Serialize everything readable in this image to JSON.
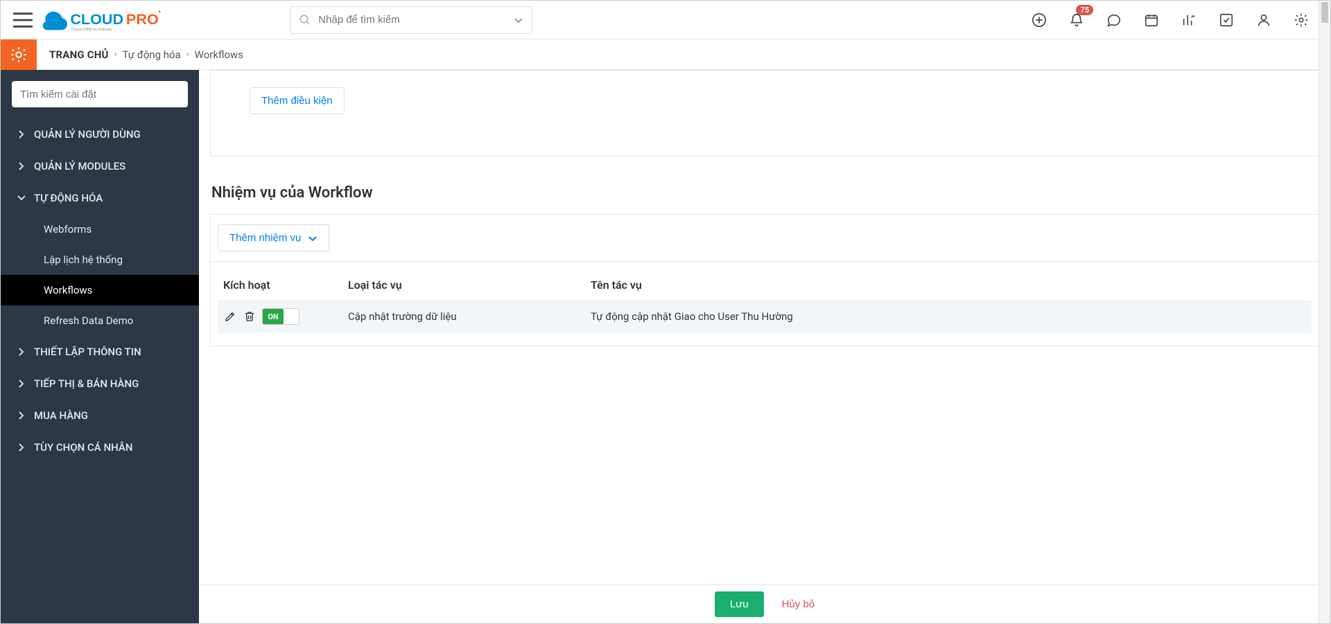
{
  "header": {
    "search_placeholder": "Nhập để tìm kiếm",
    "notification_count": "75",
    "logo": {
      "text1": "CLOUD",
      "text2": "PRO",
      "sub": "Cloud CRM by Industry"
    }
  },
  "breadcrumb": {
    "home": "TRANG CHỦ",
    "mid": "Tự động hóa",
    "last": "Workflows"
  },
  "sidebar": {
    "search_placeholder": "Tìm kiếm cài đặt",
    "items": [
      {
        "label": "QUẢN LÝ NGƯỜI DÙNG",
        "expanded": false
      },
      {
        "label": "QUẢN LÝ MODULES",
        "expanded": false
      },
      {
        "label": "TỰ ĐỘNG HÓA",
        "expanded": true,
        "children": [
          {
            "label": "Webforms",
            "active": false
          },
          {
            "label": "Lập lịch hệ thống",
            "active": false
          },
          {
            "label": "Workflows",
            "active": true
          },
          {
            "label": "Refresh Data Demo",
            "active": false
          }
        ]
      },
      {
        "label": "THIẾT LẬP THÔNG TIN",
        "expanded": false
      },
      {
        "label": "TIẾP THỊ & BÁN HÀNG",
        "expanded": false
      },
      {
        "label": "MUA HÀNG",
        "expanded": false
      },
      {
        "label": "TÙY CHỌN CÁ NHÂN",
        "expanded": false
      }
    ]
  },
  "main": {
    "add_condition": "Thêm điều kiện",
    "section_title": "Nhiệm vụ của Workflow",
    "add_task": "Thêm nhiệm vụ",
    "columns": {
      "active": "Kích hoạt",
      "type": "Loại tác vụ",
      "name": "Tên tác vụ"
    },
    "toggle_on": "ON",
    "rows": [
      {
        "type": "Cập nhật trường dữ liệu",
        "name": "Tự động cập nhật Giao cho User Thu Hường"
      }
    ]
  },
  "footer": {
    "save": "Lưu",
    "cancel": "Hủy bỏ"
  }
}
